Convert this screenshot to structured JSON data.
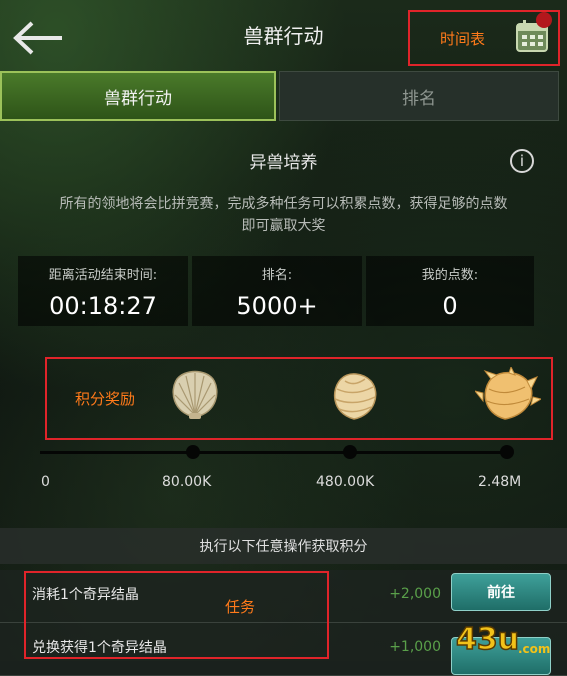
{
  "header": {
    "title": "兽群行动",
    "timetable_annotation": "时间表"
  },
  "tabs": [
    {
      "label": "兽群行动",
      "active": true
    },
    {
      "label": "排名",
      "active": false
    }
  ],
  "event": {
    "title": "异兽培养",
    "description_line1": "所有的领地将会比拼竞赛，完成多种任务可以积累点数，获得足够的点数",
    "description_line2": "即可赢取大奖"
  },
  "stats": [
    {
      "label": "距离活动结束时间:",
      "value": "00:18:27"
    },
    {
      "label": "排名:",
      "value": "5000+"
    },
    {
      "label": "我的点数:",
      "value": "0"
    }
  ],
  "rewards": {
    "annotation": "积分奖励",
    "progress_fraction": 0,
    "ticks": [
      "0",
      "80.00K",
      "480.00K",
      "2.48M"
    ]
  },
  "tasks_section": {
    "header": "执行以下任意操作获取积分",
    "annotation": "任务",
    "tasks": [
      {
        "text": "消耗1个奇异结晶",
        "reward": "+2,000",
        "button": "前往"
      },
      {
        "text": "兑换获得1个奇异结晶",
        "reward": "+1,000",
        "button": ""
      }
    ]
  },
  "watermark": "43u.com",
  "colors": {
    "annotation_red": "#e0242a",
    "annotation_text": "#ff7a1a",
    "tab_active": "#4a7a2a",
    "reward_green": "#5aa04a",
    "button_teal": "#2f8a84",
    "notification_dot": "#b3171c"
  },
  "icons": [
    "back-arrow-icon",
    "calendar-icon",
    "info-icon",
    "shell-icon"
  ]
}
